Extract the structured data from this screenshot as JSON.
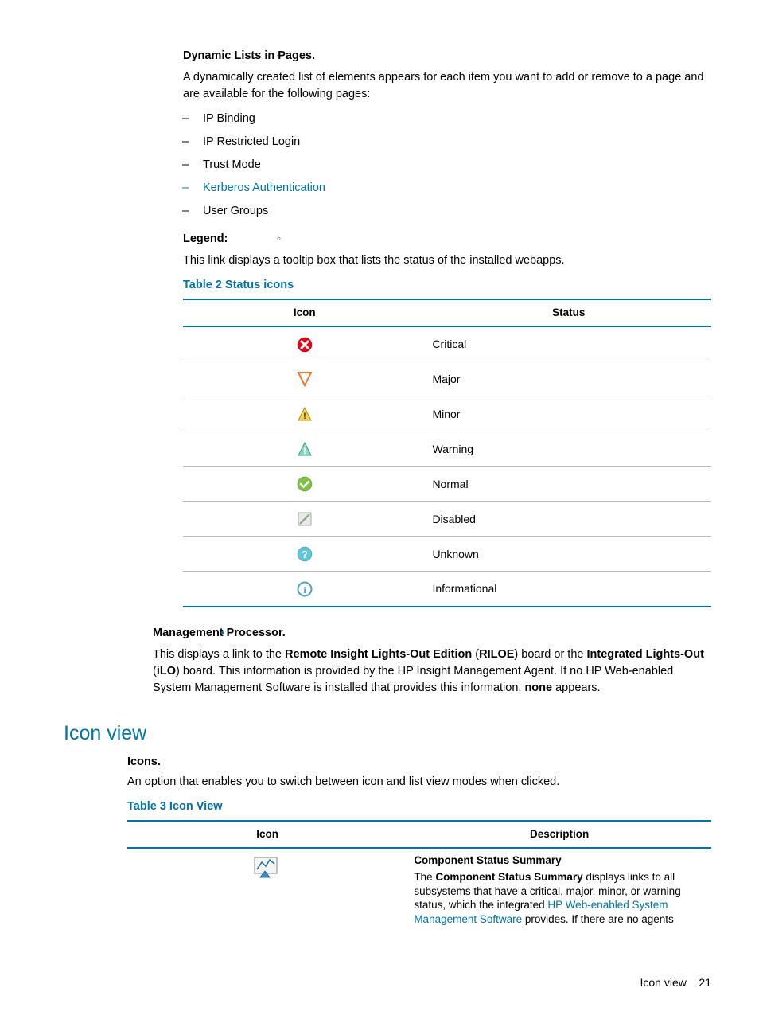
{
  "sections": {
    "dynamic_lists": {
      "title": "Dynamic Lists in Pages.",
      "body": "A dynamically created list of elements appears for each item you want to add or remove to a page and are available for the following pages:",
      "items": [
        "IP Binding",
        "IP Restricted Login",
        "Trust Mode",
        "Kerberos Authentication",
        "User Groups"
      ]
    },
    "legend": {
      "title": "Legend:",
      "body": "This link displays a tooltip box that lists the status of the installed webapps."
    },
    "table2": {
      "caption": "Table 2 Status icons",
      "headers": [
        "Icon",
        "Status"
      ],
      "rows": [
        "Critical",
        "Major",
        "Minor",
        "Warning",
        "Normal",
        "Disabled",
        "Unknown",
        "Informational"
      ]
    },
    "mgmt": {
      "title": "Management Processor.",
      "body_pre": "This displays a link to the ",
      "riloe_bold": "Remote Insight Lights-Out Edition",
      "riloe_paren": " (",
      "riloe_abbr": "RILOE",
      "body_mid": ") board or the ",
      "ilo_bold": "Integrated Lights-Out",
      "ilo_paren": " (",
      "ilo_abbr": "iLO",
      "body_post1": ") board. This information is provided by the HP Insight Management Agent. If no HP Web-enabled System Management Software is installed that provides this information, ",
      "none_bold": "none",
      "body_post2": " appears."
    },
    "iconview": {
      "heading": "Icon view",
      "subhead": "Icons.",
      "subbody": "An option that enables you to switch between icon and list view modes when clicked.",
      "caption": "Table 3 Icon View",
      "headers": [
        "Icon",
        "Description"
      ],
      "row1_title": "Component Status Summary",
      "row1_pre": "The ",
      "row1_bold": "Component Status Summary",
      "row1_mid": " displays links to all subsystems that have a critical, major, minor, or warning status, which the integrated ",
      "row1_link": "HP Web-enabled System Management Software",
      "row1_post": " provides. If there are no agents"
    }
  },
  "footer": {
    "label": "Icon view",
    "page": "21"
  }
}
